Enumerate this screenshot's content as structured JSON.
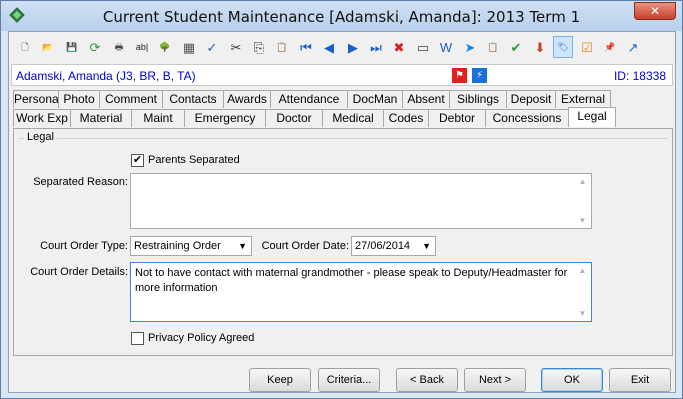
{
  "window": {
    "title": "Current Student Maintenance  [Adamski, Amanda]:  2013 Term 1",
    "close_label": "✕"
  },
  "toolbar": {
    "icons": [
      {
        "name": "new-document-icon",
        "glyph": "🗋",
        "color": "#333"
      },
      {
        "name": "open-folder-icon",
        "glyph": "📂",
        "color": "#d9a22c"
      },
      {
        "name": "save-icon",
        "glyph": "💾",
        "color": "#7a2aa0"
      },
      {
        "name": "refresh-icon",
        "glyph": "⟳",
        "color": "#2a9a3a"
      },
      {
        "name": "print-icon",
        "glyph": "🖶",
        "color": "#444"
      },
      {
        "name": "field-label-icon",
        "glyph": "ab|",
        "color": "#222"
      },
      {
        "name": "tree-icon",
        "glyph": "🌳",
        "color": "#3a9a3a"
      },
      {
        "name": "calculator-icon",
        "glyph": "▦",
        "color": "#555"
      },
      {
        "name": "spellcheck-icon",
        "glyph": "✓",
        "color": "#2a5ab0"
      },
      {
        "name": "cut-icon",
        "glyph": "✂",
        "color": "#333"
      },
      {
        "name": "copy-icon",
        "glyph": "⎘",
        "color": "#333"
      },
      {
        "name": "paste-icon",
        "glyph": "📋",
        "color": "#b08a30"
      },
      {
        "name": "first-record-icon",
        "glyph": "⏮",
        "color": "#1a5ec8"
      },
      {
        "name": "previous-record-icon",
        "glyph": "◀",
        "color": "#1a5ec8"
      },
      {
        "name": "next-record-icon",
        "glyph": "▶",
        "color": "#1a5ec8"
      },
      {
        "name": "last-record-icon",
        "glyph": "⏭",
        "color": "#1a5ec8"
      },
      {
        "name": "delete-icon",
        "glyph": "✖",
        "color": "#d42020"
      },
      {
        "name": "card-icon",
        "glyph": "▭",
        "color": "#444"
      },
      {
        "name": "word-document-icon",
        "glyph": "W",
        "color": "#1a5ec8"
      },
      {
        "name": "send-icon",
        "glyph": "➤",
        "color": "#1a8ad8"
      },
      {
        "name": "clipboard-task-icon",
        "glyph": "📋",
        "color": "#555"
      },
      {
        "name": "approve-icon",
        "glyph": "✔",
        "color": "#2a9a3a"
      },
      {
        "name": "download-icon",
        "glyph": "⬇",
        "color": "#c84020"
      },
      {
        "name": "tag-icon",
        "glyph": "🏷",
        "color": "#1a5ec8"
      },
      {
        "name": "checklist-icon",
        "glyph": "☑",
        "color": "#d98a20"
      },
      {
        "name": "pin-icon",
        "glyph": "📌",
        "color": "#1a5ec8"
      },
      {
        "name": "external-link-icon",
        "glyph": "↗",
        "color": "#1a5ec8"
      }
    ]
  },
  "infobar": {
    "student_name": "Adamski, Amanda (J3, BR, B, TA)",
    "alert_icon_red": "alert-red-icon",
    "alert_icon_blue": "alert-blue-icon",
    "student_id": "ID: 18338"
  },
  "tabs": {
    "row1": [
      "Personal",
      "Photo",
      "Comment",
      "Contacts",
      "Awards",
      "Attendance",
      "DocMan",
      "Absent",
      "Siblings",
      "Deposit",
      "External"
    ],
    "row2": [
      "Work Exp",
      "Material",
      "Maint",
      "Emergency",
      "Doctor",
      "Medical",
      "Codes",
      "Debtor",
      "Concessions",
      "Legal"
    ],
    "selected": "Legal"
  },
  "legal": {
    "group_label": "Legal",
    "parents_separated_label": "Parents Separated",
    "parents_separated_checked": true,
    "separated_reason_label": "Separated Reason:",
    "separated_reason_value": "",
    "court_order_type_label": "Court Order Type:",
    "court_order_type_value": "Restraining Order",
    "court_order_date_label": "Court Order Date:",
    "court_order_date_value": "27/06/2014",
    "court_order_details_label": "Court Order Details:",
    "court_order_details_value": "Not to have contact with maternal grandmother - please speak to Deputy/Headmaster for more information",
    "privacy_policy_label": "Privacy Policy Agreed",
    "privacy_policy_checked": false
  },
  "buttons": {
    "keep": "Keep",
    "criteria": "Criteria...",
    "back": "< Back",
    "next": "Next >",
    "ok": "OK",
    "exit": "Exit"
  }
}
